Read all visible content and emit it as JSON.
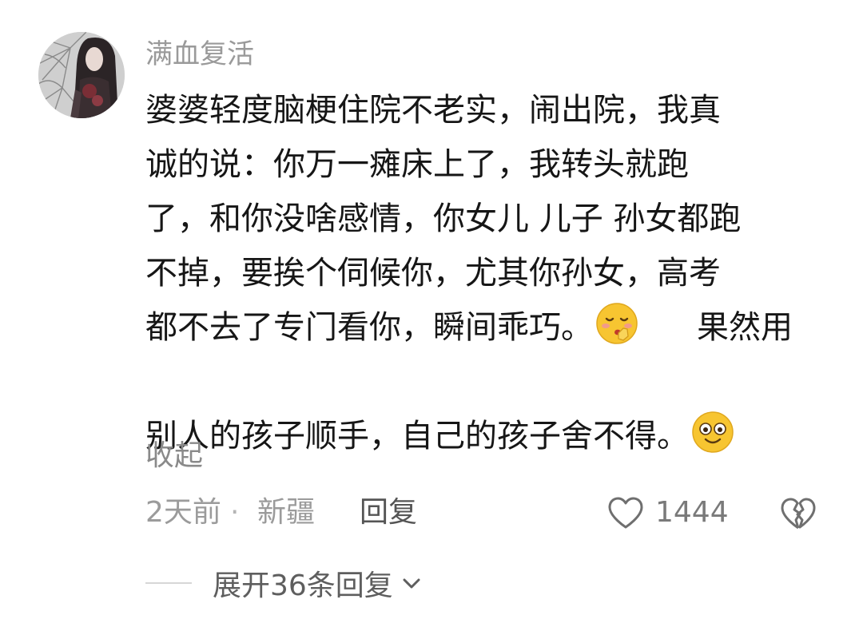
{
  "comment": {
    "username": "满血复活",
    "lines": [
      "婆婆轻度脑梗住院不老实，闹出院，我真",
      "诚的说：你万一瘫床上了，我转头就跑",
      "了，和你没啥感情，你女儿 儿子 孙女都跑",
      "不掉，要挨个伺候你，尤其你孙女，高考",
      "都不去了专门看你，瞬间乖巧。",
      "果然用",
      "别人的孩子顺手，自己的孩子舍不得。"
    ],
    "emojis": [
      "shush-emoji",
      "smile-emoji"
    ],
    "collapse_label": "收起",
    "time": "2天前",
    "separator": "·",
    "location": "新疆",
    "reply_label": "回复",
    "like_count": "1444",
    "expand_label": "展开36条回复"
  },
  "colors": {
    "secondary_text": "#9b9b9b",
    "body_text": "#161616",
    "emoji_yellow": "#f7c531"
  }
}
